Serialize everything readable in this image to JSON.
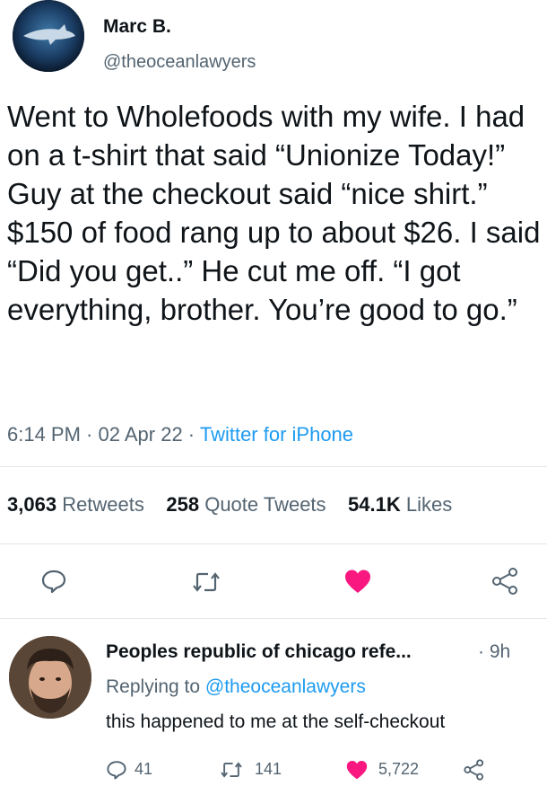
{
  "tweet": {
    "author_name": "Marc B.",
    "author_handle": "@theoceanlawyers",
    "text": "Went to Wholefoods with my wife. I had on a t-shirt that said “Unionize Today!” Guy at the checkout said “nice shirt.” $150 of food rang up to about $26. I said “Did you get..” He cut me off. “I got everything, brother. You’re good to go.”",
    "time": "6:14 PM",
    "sep1": " · ",
    "date": "02 Apr 22",
    "sep2": " · ",
    "source": "Twitter for iPhone",
    "retweets_count": "3,063",
    "retweets_label": "Retweets",
    "quotes_count": "258",
    "quotes_label": "Quote Tweets",
    "likes_count": "54.1K",
    "likes_label": "Likes"
  },
  "reply": {
    "author_name": "Peoples republic of chicago refe...",
    "time_sep": "·",
    "time": "9h",
    "replying_prefix": "Replying to ",
    "replying_handle": "@theoceanlawyers",
    "text": "this happened to me at the self-checkout",
    "reply_count": "41",
    "retweet_count": "141",
    "like_count": "5,722"
  },
  "colors": {
    "link": "#1d9bf0",
    "like": "#f91880",
    "secondary_text": "#536471",
    "icon_gray": "#536471"
  }
}
